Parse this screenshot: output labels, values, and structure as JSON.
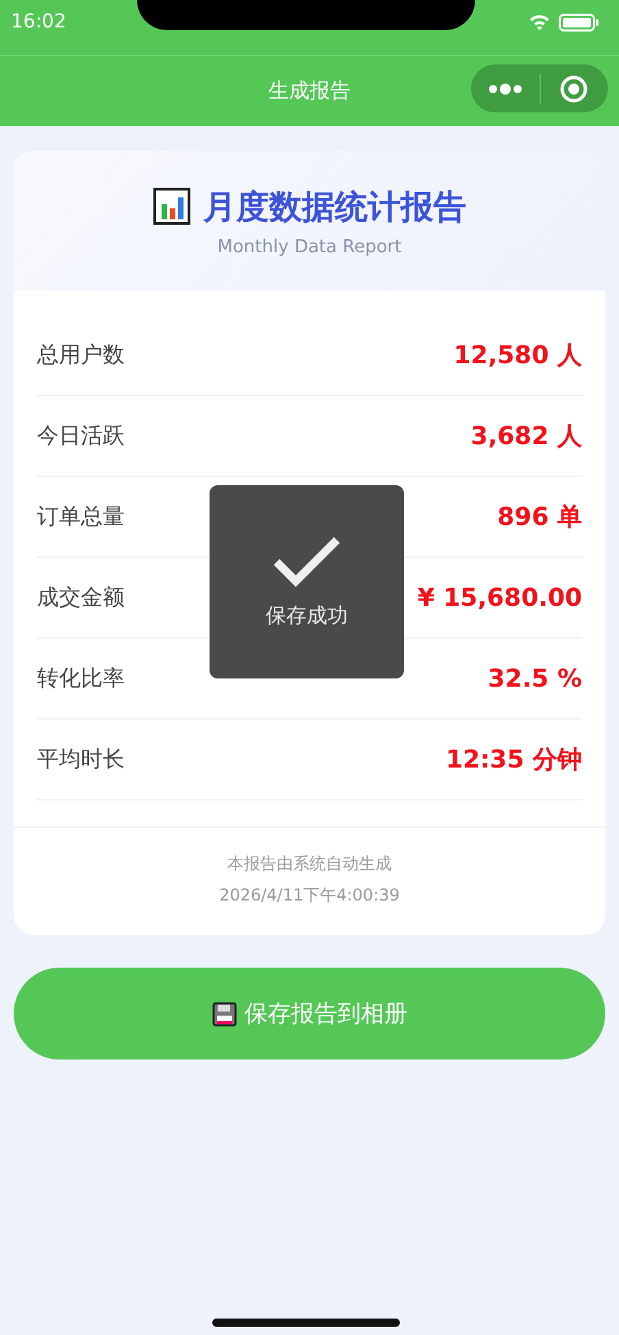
{
  "status_bar": {
    "time": "16:02"
  },
  "nav_bar": {
    "title": "生成报告"
  },
  "report": {
    "title": "月度数据统计报告",
    "subtitle": "Monthly Data Report",
    "rows": [
      {
        "label": "总用户数",
        "value": "12,580 人"
      },
      {
        "label": "今日活跃",
        "value": "3,682 人"
      },
      {
        "label": "订单总量",
        "value": "896 单"
      },
      {
        "label": "成交金额",
        "value": "¥ 15,680.00"
      },
      {
        "label": "转化比率",
        "value": "32.5 %"
      },
      {
        "label": "平均时长",
        "value": "12:35 分钟"
      }
    ],
    "footer_note": "本报告由系统自动生成",
    "generated_at": "2026/4/11下午4:00:39"
  },
  "save_button": {
    "label": "保存报告到相册"
  },
  "toast": {
    "message": "保存成功"
  }
}
